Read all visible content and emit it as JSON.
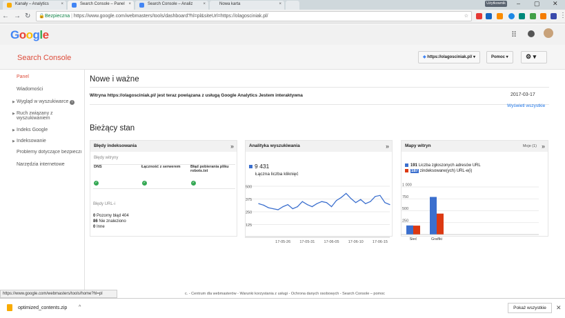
{
  "browser": {
    "tabs": [
      {
        "label": "Kanały – Analytics",
        "active": false
      },
      {
        "label": "Search Console – Panel",
        "active": true
      },
      {
        "label": "Search Console – Analiz",
        "active": false
      },
      {
        "label": "Nowa karta",
        "active": false
      }
    ],
    "user_badge": "Użytkownik",
    "secure_label": "Bezpieczna",
    "url": "https://www.google.com/webmasters/tools/dashboard?hl=pl&siteUrl=https://olagosciniak.pl/"
  },
  "google": {
    "logo": "Google"
  },
  "header": {
    "title": "Search Console",
    "site_dropdown": "https://olagosciniak.pl/",
    "help_dropdown": "Pomoc"
  },
  "sidebar": {
    "items": [
      {
        "label": "Panel",
        "active": true
      },
      {
        "label": "Wiadomości"
      },
      {
        "label": "Wygląd w wyszukiwarce"
      },
      {
        "label": "Ruch związany z"
      },
      {
        "label": "wyszukiwaniem"
      },
      {
        "label": "Indeks Google"
      },
      {
        "label": "Indeksowanie"
      },
      {
        "label": "Problemy dotyczące bezpieczi"
      },
      {
        "label": "Narzędzia internetowe"
      }
    ]
  },
  "news": {
    "heading": "Nowe i ważne",
    "message": "Witryna https://olagosciniak.pl/ jest teraz powiązana z usługą Google Analytics Jestem interaktywna",
    "date": "2017-03-17",
    "show_all": "Wyświetl wszystkie"
  },
  "state": {
    "heading": "Bieżący stan",
    "errors_card": {
      "title": "Błędy indeksowania",
      "site_errors_label": "Błędy witryny",
      "columns": [
        "DNS",
        "Łączność z serwerem",
        "Błąd pobierania pliku robots.txt"
      ],
      "url_errors_label": "Błędy URL-i",
      "url_errors": [
        {
          "count": "0",
          "label": "Pozorny błąd 404"
        },
        {
          "count": "86",
          "label": "Nie znaleziono"
        },
        {
          "count": "0",
          "label": "Inne"
        }
      ]
    },
    "analytics_card": {
      "title": "Analityka wyszukiwania",
      "total": "9 431",
      "total_label": "Łączna liczba kliknięć"
    },
    "sitemaps_card": {
      "title": "Mapy witryn",
      "mine_label": "Moje (1)",
      "legend": [
        {
          "count": "191",
          "label": "Liczba zgłoszonych adresów URL",
          "color": "#3b6fce"
        },
        {
          "count": "187",
          "label": "zindeksowane(ych) URL-e(i)",
          "color": "#dc3912"
        }
      ]
    }
  },
  "chart_data": [
    {
      "type": "line",
      "title": "Analityka wyszukiwania",
      "x": [
        "17-05-21",
        "17-05-22",
        "17-05-23",
        "17-05-24",
        "17-05-25",
        "17-05-26",
        "17-05-27",
        "17-05-28",
        "17-05-29",
        "17-05-30",
        "17-05-31",
        "17-06-01",
        "17-06-02",
        "17-06-03",
        "17-06-04",
        "17-06-05",
        "17-06-06",
        "17-06-07",
        "17-06-08",
        "17-06-09",
        "17-06-10",
        "17-06-11",
        "17-06-12",
        "17-06-13",
        "17-06-14",
        "17-06-15",
        "17-06-16",
        "17-06-17"
      ],
      "series": [
        {
          "values": [
            330,
            315,
            290,
            280,
            270,
            300,
            320,
            280,
            300,
            350,
            320,
            300,
            330,
            350,
            340,
            300,
            360,
            390,
            430,
            380,
            340,
            370,
            330,
            350,
            400,
            410,
            340,
            320
          ]
        }
      ],
      "x_ticks": [
        "17-05-26",
        "17-05-31",
        "17-06-05",
        "17-06-10",
        "17-06-15"
      ],
      "y_ticks": [
        "500",
        "375",
        "250",
        "125"
      ],
      "ylim": [
        0,
        500
      ],
      "grid": true
    },
    {
      "type": "bar",
      "title": "Mapy witryn",
      "categories": [
        "Sieć",
        "Grafiki"
      ],
      "series": [
        {
          "name": "Liczba zgłoszonych adresów URL",
          "values": [
            191,
            790
          ]
        },
        {
          "name": "zindeksowane(ych) URL-e(i)",
          "values": [
            187,
            440
          ]
        }
      ],
      "y_ticks": [
        "1 000",
        "750",
        "500",
        "250"
      ],
      "ylim": [
        0,
        1000
      ],
      "grid": true
    }
  ],
  "status_bar": {
    "url": "https://www.google.com/webmasters/tools/home?hl=pl"
  },
  "footer": {
    "text": "c. - Centrum dla webmasterów - Warunki korzystania z usługi - Ochrona danych osobowych - Search Console – pomoc"
  },
  "downloads": {
    "file": "optimized_contents.zip",
    "show_all": "Pokaż wszystkie"
  }
}
